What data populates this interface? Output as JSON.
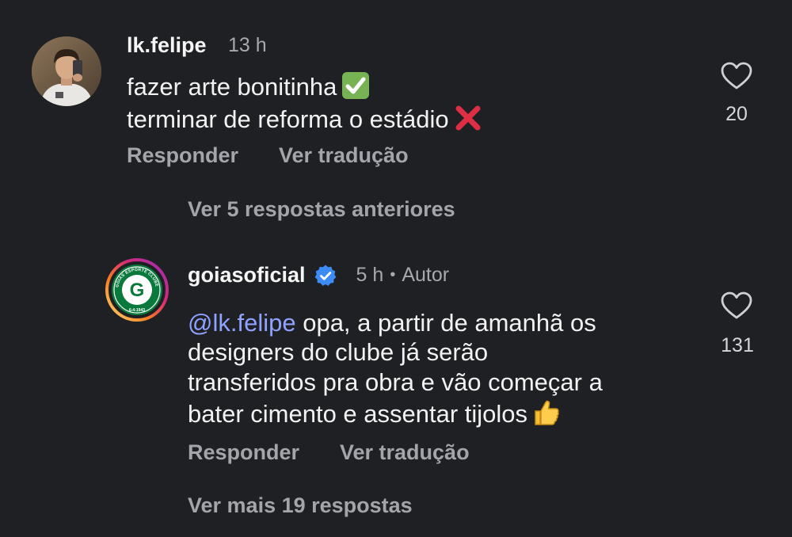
{
  "comments": [
    {
      "username": "lk.felipe",
      "time": "13 h",
      "lines": [
        "fazer arte bonitinha",
        "terminar de reforma o estádio"
      ],
      "line_emojis": [
        "check-mark-emoji",
        "cross-mark-emoji"
      ],
      "likes": "20",
      "actions": {
        "reply": "Responder",
        "translate": "Ver tradução"
      }
    },
    {
      "username": "goiasoficial",
      "verified": true,
      "time": "5 h",
      "separator": "•",
      "author_badge": "Autor",
      "mention": "@lk.felipe",
      "lines": [
        " opa, a partir de amanhã os",
        "designers do clube já serão",
        "transferidos pra obra e vão começar a",
        "bater cimento e assentar tijolos"
      ],
      "line_emojis": [
        "thumbs-up-emoji"
      ],
      "likes": "131",
      "actions": {
        "reply": "Responder",
        "translate": "Ver tradução"
      }
    }
  ],
  "view_previous_replies": "Ver 5 respostas anteriores",
  "view_more_replies": "Ver mais 19 respostas",
  "logo_text": {
    "ring": "GOIÁS ESPORTE CLUBE",
    "letter": "G",
    "date": "6-4-1943"
  },
  "colors": {
    "background": "#1f2023",
    "mention": "#8fa2ff",
    "verified": "#3d8bf5",
    "logo_green": "#0a7a3c"
  }
}
